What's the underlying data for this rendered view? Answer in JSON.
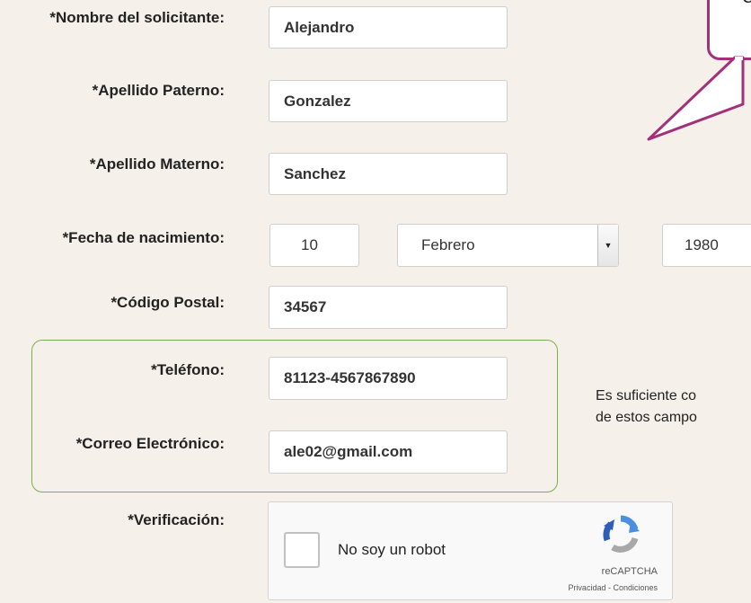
{
  "form": {
    "nombre": {
      "label": "*Nombre del solicitante:",
      "value": "Alejandro"
    },
    "paterno": {
      "label": "*Apellido Paterno:",
      "value": "Gonzalez"
    },
    "materno": {
      "label": "*Apellido Materno:",
      "value": "Sanchez"
    },
    "nacimiento": {
      "label": "*Fecha de nacimiento:",
      "day": "10",
      "month": "Febrero",
      "year": "1980"
    },
    "postal": {
      "label": "*Código Postal:",
      "value": "34567"
    },
    "telefono": {
      "label": "*Teléfono:",
      "value": "81123-4567867890"
    },
    "correo": {
      "label": "*Correo Electrónico:",
      "value": "ale02@gmail.com"
    },
    "verificacion": {
      "label": "*Verificación:"
    }
  },
  "captcha": {
    "checkbox_label": "No soy un robot",
    "brand": "reCAPTCHA",
    "links": "Privacidad - Condiciones"
  },
  "annotations": {
    "callout_text": "C",
    "note_line1": "Es suficiente co",
    "note_line2": "de estos campo",
    "accent_colors": {
      "callout": "#a3307a",
      "group": "#7ab04a"
    }
  }
}
